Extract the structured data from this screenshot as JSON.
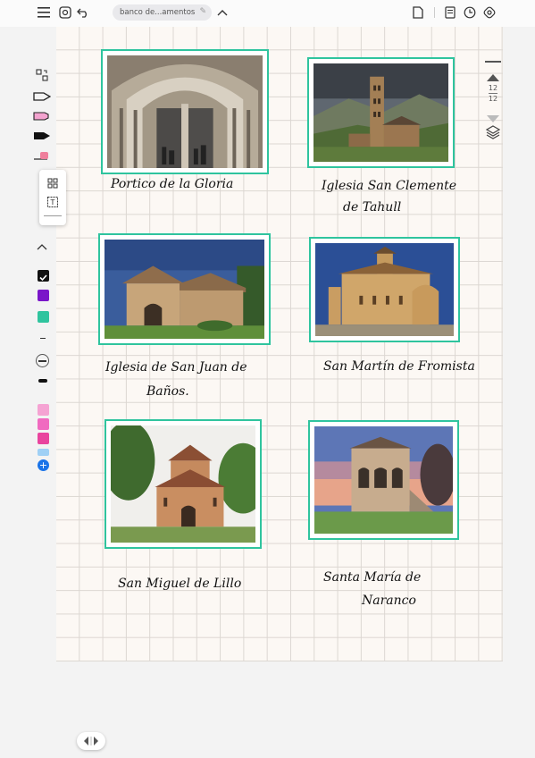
{
  "topbar": {
    "doc_title": "banco de...amentos",
    "icons": [
      "menu-icon",
      "ai-icon",
      "undo-icon",
      "edit-icon",
      "chevron-up-icon",
      "page-icon",
      "read-mode-icon",
      "timer-icon",
      "settings-icon"
    ]
  },
  "nav": {
    "page_current": "12",
    "page_total": "12"
  },
  "captions": {
    "c1": "Portico de la Gloria",
    "c2_l1": "Iglesia San Clemente",
    "c2_l2": "de Tahull",
    "c3_l1": "Iglesia de San Juan de",
    "c3_l2": "Baños.",
    "c4": "San Martín de Fromista",
    "c5": "San Miguel de Lillo",
    "c6_l1": "Santa María de",
    "c6_l2": "Naranco"
  },
  "colors": {
    "frame": "#2fc49e",
    "swatches": [
      "#111111",
      "#7a16c9",
      "#2fc49e",
      "#f5a3d3",
      "#f06ac0",
      "#e9449e",
      "#9fd0f5",
      "#1a73e8"
    ]
  }
}
